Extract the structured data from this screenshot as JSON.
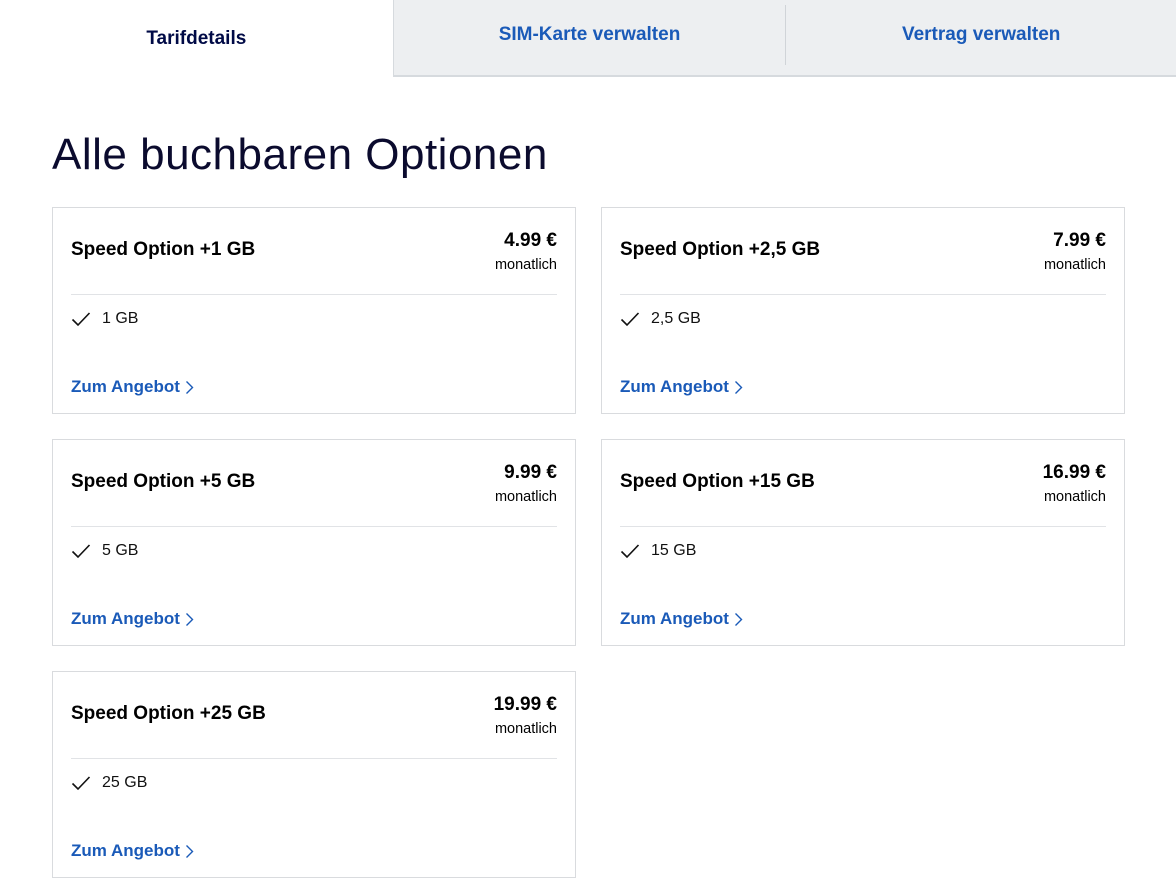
{
  "tabs": [
    {
      "label": "Tarifdetails",
      "active": true
    },
    {
      "label": "SIM-Karte verwalten",
      "active": false
    },
    {
      "label": "Vertrag verwalten",
      "active": false
    }
  ],
  "heading": "Alle buchbaren Optionen",
  "colors": {
    "accent_link": "#1a5ab8",
    "active_tab_text": "#000a46",
    "inactive_tab_bg": "#edeff1"
  },
  "cards": [
    {
      "title": "Speed Option +1 GB",
      "price": "4.99 €",
      "period": "monatlich",
      "feature": "1 GB",
      "cta": "Zum Angebot",
      "feature_icon": "check-icon",
      "cta_icon": "chevron-right-icon"
    },
    {
      "title": "Speed Option +2,5 GB",
      "price": "7.99 €",
      "period": "monatlich",
      "feature": "2,5 GB",
      "cta": "Zum Angebot",
      "feature_icon": "check-icon",
      "cta_icon": "chevron-right-icon"
    },
    {
      "title": "Speed Option +5 GB",
      "price": "9.99 €",
      "period": "monatlich",
      "feature": "5 GB",
      "cta": "Zum Angebot",
      "feature_icon": "check-icon",
      "cta_icon": "chevron-right-icon"
    },
    {
      "title": "Speed Option +15 GB",
      "price": "16.99 €",
      "period": "monatlich",
      "feature": "15 GB",
      "cta": "Zum Angebot",
      "feature_icon": "check-icon",
      "cta_icon": "chevron-right-icon"
    },
    {
      "title": "Speed Option +25 GB",
      "price": "19.99 €",
      "period": "monatlich",
      "feature": "25 GB",
      "cta": "Zum Angebot",
      "feature_icon": "check-icon",
      "cta_icon": "chevron-right-icon"
    }
  ]
}
